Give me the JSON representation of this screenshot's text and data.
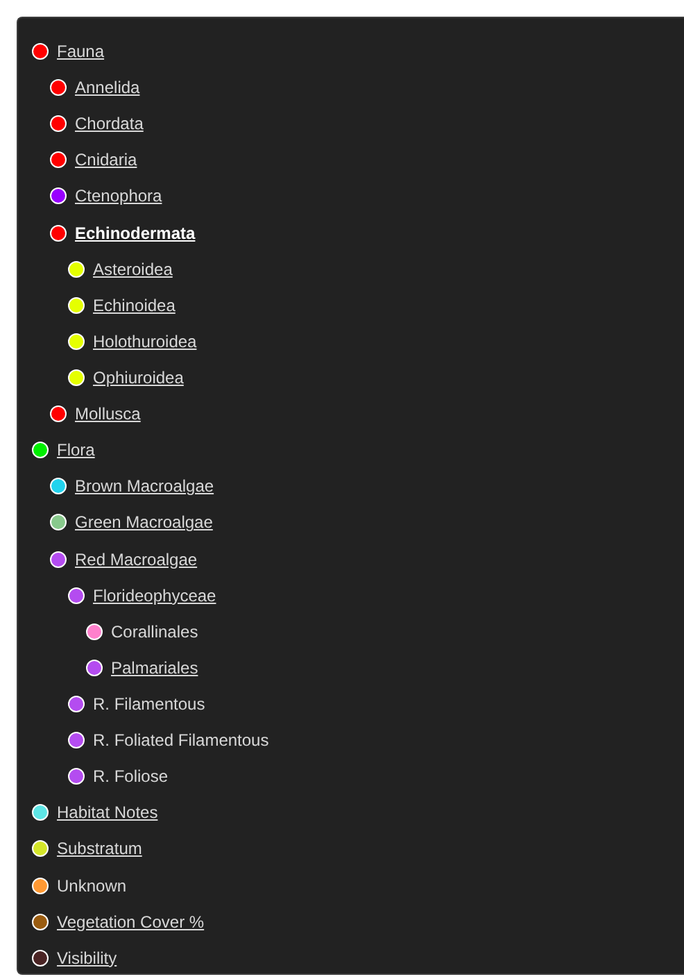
{
  "tree": [
    {
      "label": "Fauna",
      "color": "#ff0000",
      "link": true,
      "selected": false,
      "children": [
        {
          "label": "Annelida",
          "color": "#ff0000",
          "link": true,
          "selected": false
        },
        {
          "label": "Chordata",
          "color": "#ff0000",
          "link": true,
          "selected": false
        },
        {
          "label": "Cnidaria",
          "color": "#ff0000",
          "link": true,
          "selected": false
        },
        {
          "label": "Ctenophora",
          "color": "#9900ff",
          "link": true,
          "selected": false
        },
        {
          "label": "Echinodermata",
          "color": "#ff0000",
          "link": true,
          "selected": true,
          "children": [
            {
              "label": "Asteroidea",
              "color": "#e5ff00",
              "link": true,
              "selected": false
            },
            {
              "label": "Echinoidea",
              "color": "#e5ff00",
              "link": true,
              "selected": false
            },
            {
              "label": "Holothuroidea",
              "color": "#e5ff00",
              "link": true,
              "selected": false
            },
            {
              "label": "Ophiuroidea",
              "color": "#e5ff00",
              "link": true,
              "selected": false
            }
          ]
        },
        {
          "label": "Mollusca",
          "color": "#ff0000",
          "link": true,
          "selected": false
        }
      ]
    },
    {
      "label": "Flora",
      "color": "#00ee00",
      "link": true,
      "selected": false,
      "children": [
        {
          "label": "Brown Macroalgae",
          "color": "#22d3ee",
          "link": true,
          "selected": false
        },
        {
          "label": "Green Macroalgae",
          "color": "#88c98c",
          "link": true,
          "selected": false
        },
        {
          "label": "Red Macroalgae",
          "color": "#b44cf0",
          "link": true,
          "selected": false,
          "children": [
            {
              "label": "Florideophyceae",
              "color": "#b44cf0",
              "link": true,
              "selected": false,
              "children": [
                {
                  "label": "Corallinales",
                  "color": "#ff80cc",
                  "link": false,
                  "selected": false
                },
                {
                  "label": "Palmariales",
                  "color": "#b44cf0",
                  "link": true,
                  "selected": false
                }
              ]
            },
            {
              "label": "R. Filamentous",
              "color": "#b44cf0",
              "link": false,
              "selected": false
            },
            {
              "label": "R. Foliated Filamentous",
              "color": "#b44cf0",
              "link": false,
              "selected": false
            },
            {
              "label": "R. Foliose",
              "color": "#b44cf0",
              "link": false,
              "selected": false
            }
          ]
        }
      ]
    },
    {
      "label": "Habitat Notes",
      "color": "#5ee6e6",
      "link": true,
      "selected": false
    },
    {
      "label": "Substratum",
      "color": "#d4e62a",
      "link": true,
      "selected": false
    },
    {
      "label": "Unknown",
      "color": "#ff9933",
      "link": false,
      "selected": false
    },
    {
      "label": "Vegetation Cover %",
      "color": "#9a5c10",
      "link": true,
      "selected": false
    },
    {
      "label": "Visibility",
      "color": "#4a2424",
      "link": true,
      "selected": false
    }
  ]
}
